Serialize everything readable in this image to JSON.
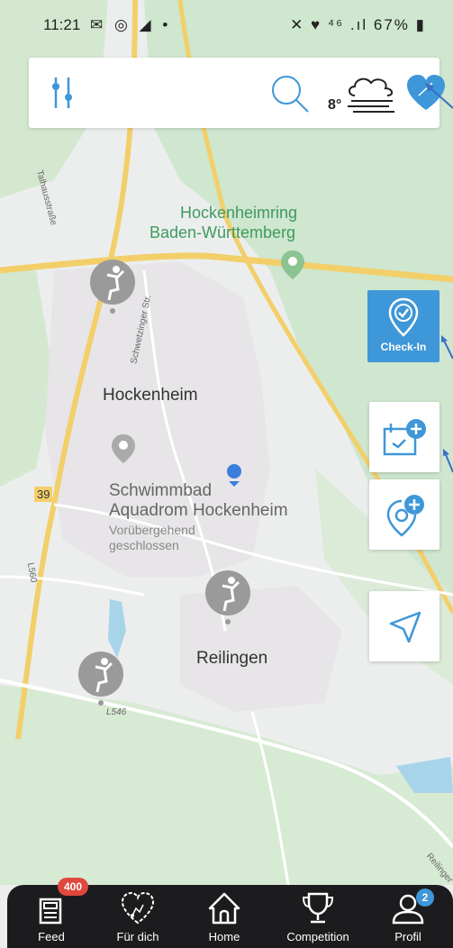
{
  "status_bar": {
    "time": "11:21",
    "left_icons": "✉ ◎ ◢ •",
    "right_icons": "✕ ♥ ⁴⁶ .ıl",
    "battery": "67%"
  },
  "top_bar": {
    "temperature": "8°",
    "filter_icon": "sliders-icon",
    "search_icon": "search-icon",
    "weather_icon": "fog-cloud-icon",
    "favorite_icon": "heart-icon",
    "accent_color": "#3e97d8"
  },
  "map": {
    "labels": {
      "hockenheimring": "Hockenheimring",
      "baden": "Baden-Württemberg",
      "hockenheim": "Hockenheim",
      "schwimmbad": "Schwimmbad",
      "aquadrom": "Aquadrom Hockenheim",
      "voruebergehend": "Vorübergehend",
      "geschlossen": "geschlossen",
      "reilingen": "Reilingen",
      "talhaus": "Talhausstraße",
      "schwetzinger": "Schwetzinger Str.",
      "road39": "39",
      "l560": "L560",
      "l546": "L546",
      "reilinger": "Reilinger"
    }
  },
  "side_buttons": {
    "checkin_label": "Check-In",
    "add_event_icon": "calendar-plus-icon",
    "add_location_icon": "location-plus-icon",
    "navigate_icon": "navigation-arrow-icon"
  },
  "bottom_nav": {
    "items": [
      {
        "label": "Feed",
        "badge": "400",
        "icon": "feed-icon"
      },
      {
        "label": "Für dich",
        "icon": "heart-path-icon"
      },
      {
        "label": "Home",
        "icon": "home-icon"
      },
      {
        "label": "Competition",
        "icon": "trophy-icon"
      },
      {
        "label": "Profil",
        "badge": "2",
        "icon": "profile-icon"
      }
    ]
  }
}
